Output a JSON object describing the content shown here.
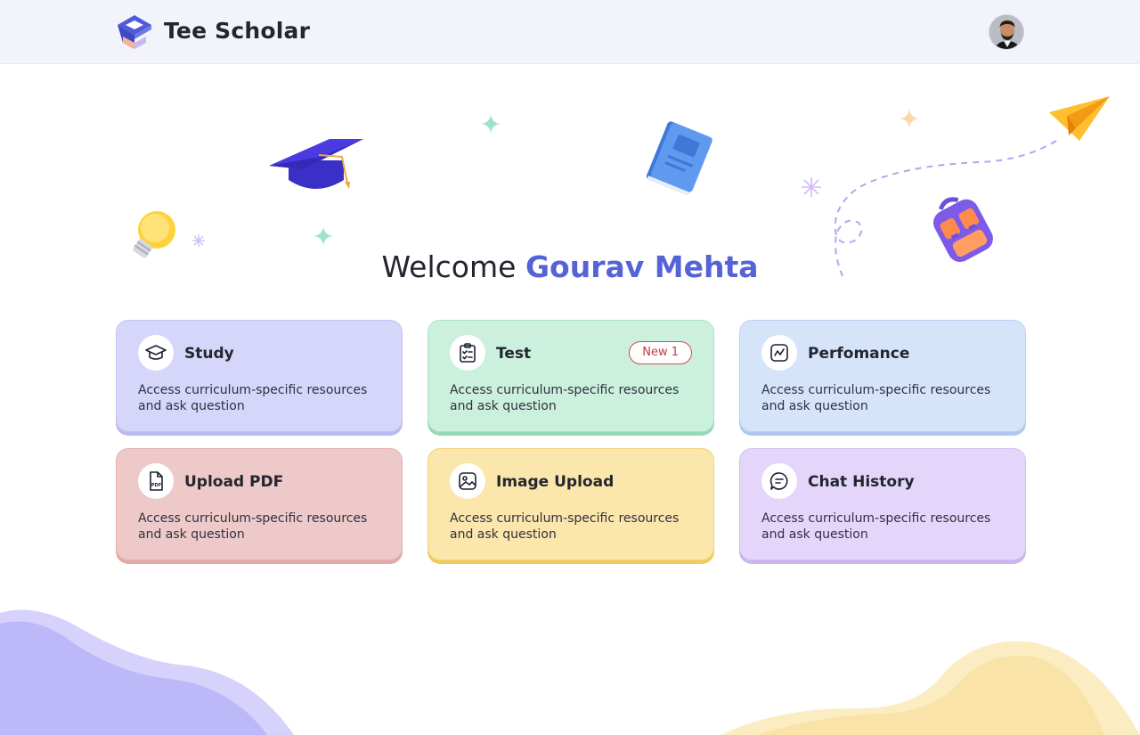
{
  "header": {
    "app_name": "Tee Scholar",
    "logo_icon": "stacked-cube-logo",
    "avatar": "user-avatar"
  },
  "welcome": {
    "greeting": "Welcome",
    "user_name": "Gourav Mehta"
  },
  "cards": [
    {
      "id": "study",
      "title": "Study",
      "description": "Access curriculum-specific resources and ask question",
      "icon": "graduation-cap-icon",
      "color": "#d6d6fa"
    },
    {
      "id": "test",
      "title": "Test",
      "description": "Access curriculum-specific resources and ask question",
      "icon": "clipboard-check-icon",
      "badge": "New 1",
      "color": "#ccf0de"
    },
    {
      "id": "performance",
      "title": "Perfomance",
      "description": "Access curriculum-specific resources and ask question",
      "icon": "chart-line-icon",
      "color": "#d6e4fa"
    },
    {
      "id": "upload-pdf",
      "title": "Upload PDF",
      "description": "Access curriculum-specific resources and ask question",
      "icon": "pdf-file-icon",
      "color": "#eec9c9"
    },
    {
      "id": "image-upload",
      "title": "Image Upload",
      "description": "Access curriculum-specific resources and ask question",
      "icon": "image-icon",
      "color": "#fbe6ab"
    },
    {
      "id": "chat-history",
      "title": "Chat History",
      "description": "Access curriculum-specific resources and ask question",
      "icon": "chat-bubble-icon",
      "color": "#e4d6fa"
    }
  ],
  "colors": {
    "accent": "#5563d6",
    "header_bg": "#f3f4fb",
    "badge": "#d24b4b"
  }
}
